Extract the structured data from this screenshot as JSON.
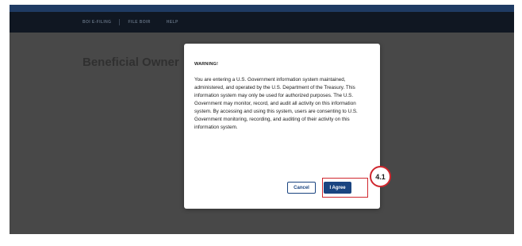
{
  "nav": {
    "items": [
      "BOI E-FILING",
      "FILE BOIR",
      "HELP"
    ]
  },
  "page": {
    "heading": "Beneficial Owner"
  },
  "modal": {
    "title": "WARNING!",
    "body": "You are entering a U.S. Government information system maintained, administered, and operated by the U.S. Department of the Treasury. This information system may only be used for authorized purposes. The U.S. Government may monitor, record, and audit all activity on this information system. By accessing and using this system, users are consenting to U.S. Government monitoring, recording, and auditing of their activity on this information system.",
    "cancel_label": "Cancel",
    "agree_label": "I Agree"
  },
  "annotation": {
    "step_label": "4.1",
    "highlight_color": "#d0272e"
  },
  "colors": {
    "primary_button": "#1a4480",
    "navbar": "#101722",
    "top_stripe": "#1f3b63"
  }
}
